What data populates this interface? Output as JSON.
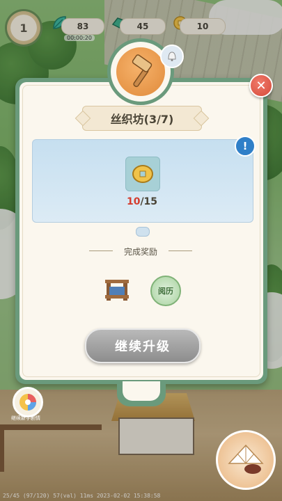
{
  "hud": {
    "level": "1",
    "resources": [
      {
        "name": "wood",
        "value": "83",
        "icon": "leaf-icon"
      },
      {
        "name": "jade",
        "value": "45",
        "icon": "jade-icon"
      },
      {
        "name": "coin",
        "value": "10",
        "icon": "coin-icon"
      }
    ],
    "timer": "00:00:20"
  },
  "dialog": {
    "title": "丝织坊(3/7)",
    "requirement": {
      "current": "10",
      "total": "/15",
      "icon": "coin-icon"
    },
    "reward_header": "完成奖励",
    "rewards": [
      {
        "name": "loom",
        "icon": "loom-icon"
      },
      {
        "name": "exp",
        "label": "阅历"
      }
    ],
    "continue_button": "继续升级",
    "close_label": "✕",
    "info_label": "!"
  },
  "footer": {
    "debug_text": "25/45 (97/120) 57(val) 11ms 2023-02-02 15:38:58",
    "mini_badge_label": "继续新手剧情"
  },
  "colors": {
    "dialog_frame": "#6a9a7c",
    "panel_bg": "#fbf7ee",
    "close_red": "#d54a3a",
    "progress_current": "#d43c2e",
    "button_gray": "#8d8d8d"
  }
}
